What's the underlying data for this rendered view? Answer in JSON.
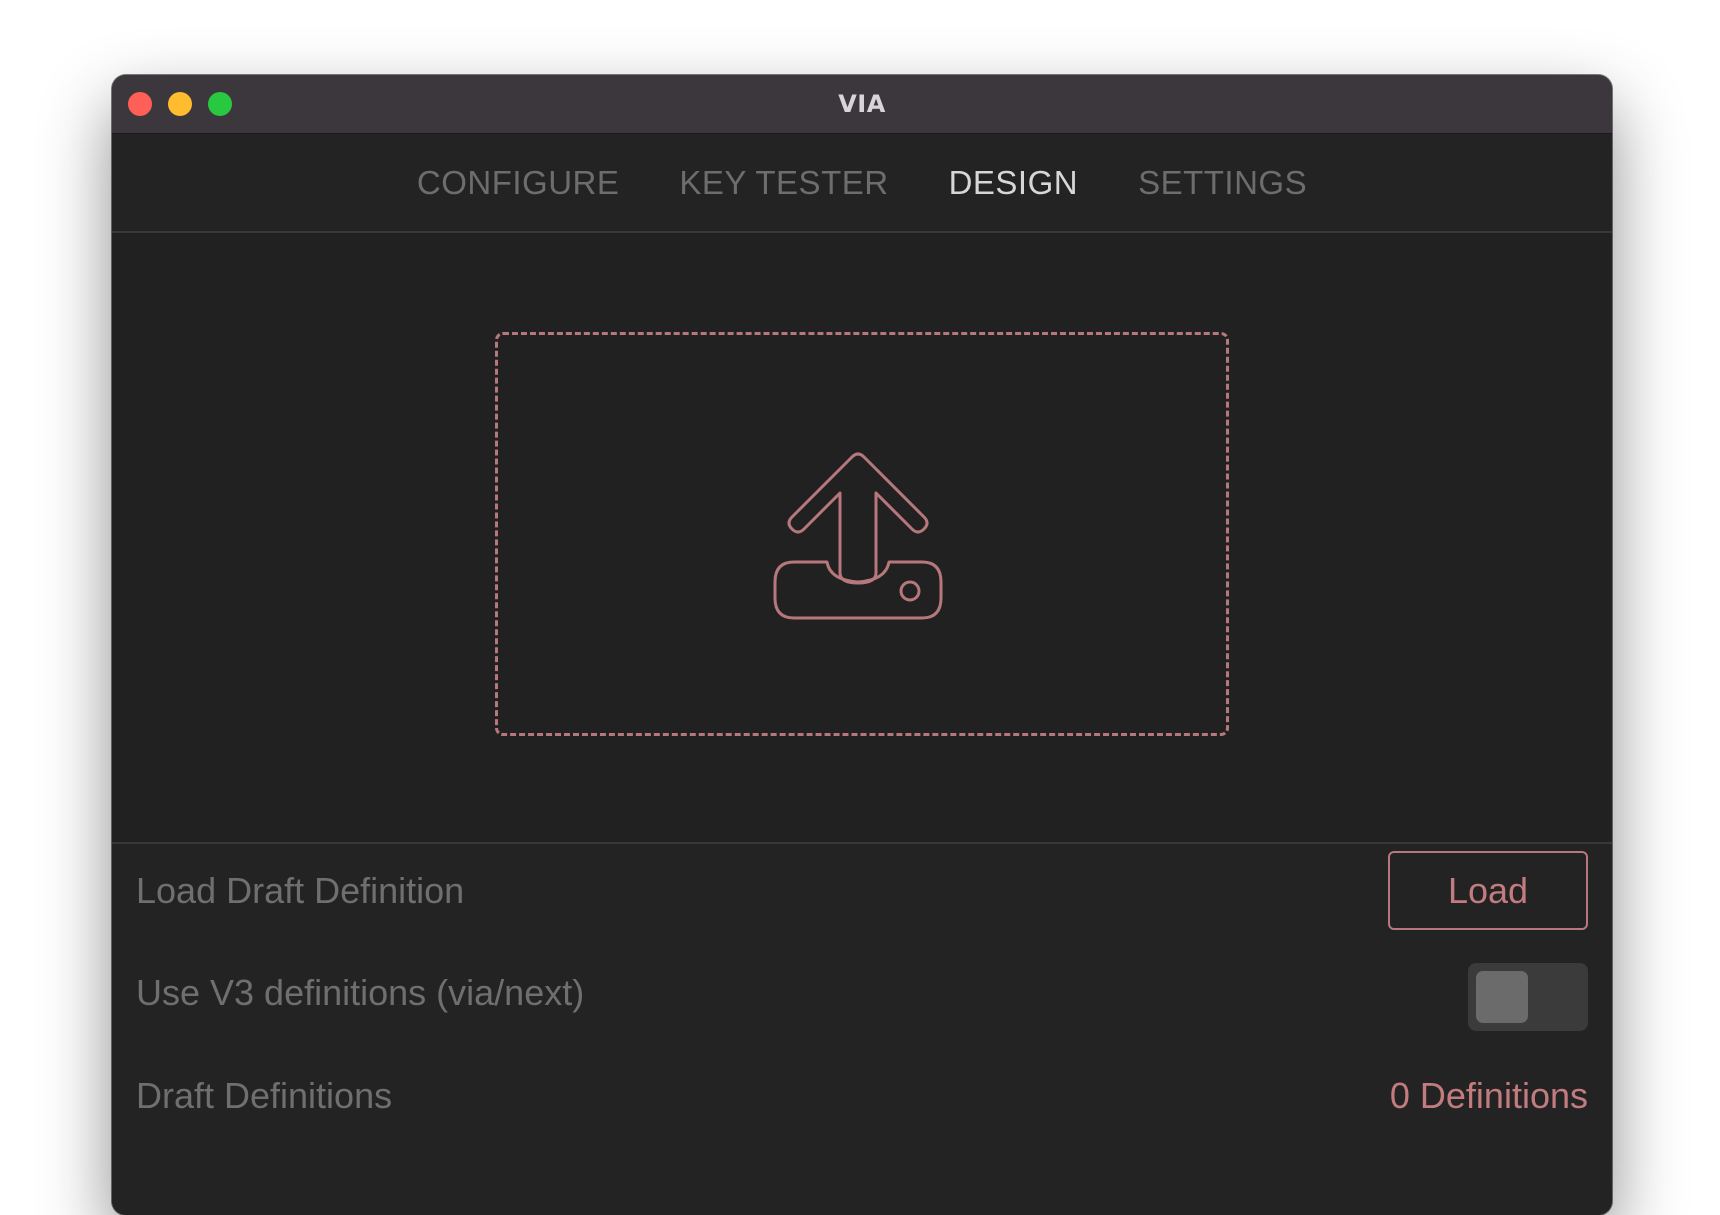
{
  "window": {
    "title": "VIA"
  },
  "nav": {
    "tabs": [
      {
        "label": "CONFIGURE",
        "active": false
      },
      {
        "label": "KEY TESTER",
        "active": false
      },
      {
        "label": "DESIGN",
        "active": true
      },
      {
        "label": "SETTINGS",
        "active": false
      }
    ]
  },
  "dropzone": {
    "icon": "upload-icon",
    "accent_color": "#b6787c"
  },
  "settings": {
    "load_draft": {
      "label": "Load Draft Definition",
      "button_label": "Load"
    },
    "use_v3": {
      "label": "Use V3 definitions (via/next)",
      "enabled": false
    },
    "draft_definitions": {
      "label": "Draft Definitions",
      "count_text": "0 Definitions"
    }
  },
  "colors": {
    "accent": "#c27c80",
    "background": "#222222",
    "titlebar": "#3c373d"
  }
}
